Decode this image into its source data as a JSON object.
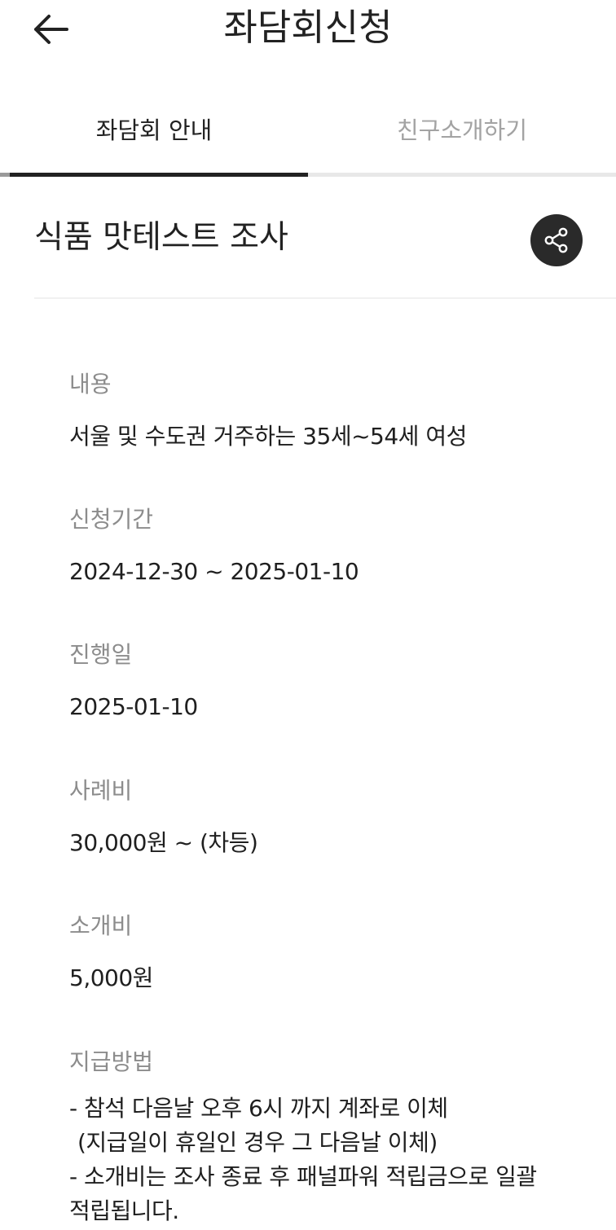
{
  "header": {
    "title": "좌담회신청",
    "back_icon": "arrow-left-icon"
  },
  "tabs": [
    {
      "label": "좌담회 안내",
      "active": true
    },
    {
      "label": "친구소개하기",
      "active": false
    }
  ],
  "survey": {
    "title": "식품 맛테스트 조사",
    "share_icon": "share-icon"
  },
  "fields": {
    "content": {
      "label": "내용",
      "value": "서울 및 수도권 거주하는 35세~54세 여성"
    },
    "period": {
      "label": "신청기간",
      "value": "2024-12-30 ~ 2025-01-10"
    },
    "date": {
      "label": "진행일",
      "value": "2025-01-10"
    },
    "reward": {
      "label": "사례비",
      "value": "30,000원 ~ (차등)"
    },
    "referral_fee": {
      "label": "소개비",
      "value": "5,000원"
    },
    "payment": {
      "label": "지급방법",
      "lines": [
        "- 참석 다음날 오후 6시 까지 계좌로 이체",
        "(지급일이 휴일인 경우 그 다음날 이체)",
        "- 소개비는 조사 종료 후 패널파워 적립금으로 일괄",
        "적립됩니다."
      ]
    }
  },
  "colors": {
    "text_primary": "#222222",
    "text_muted": "#8c8c8c",
    "tab_inactive": "#a3a3a3",
    "share_bg": "#2a2a2a"
  }
}
